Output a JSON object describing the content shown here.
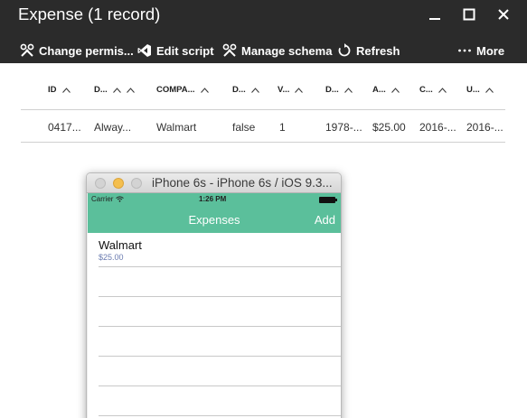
{
  "blade": {
    "title": "Expense (1 record)"
  },
  "toolbar": {
    "change_permissions": "Change permis...",
    "edit_script": "Edit script",
    "manage_schema": "Manage schema",
    "refresh": "Refresh",
    "more": "More"
  },
  "table": {
    "columns": [
      "ID",
      "D...",
      "COMPA...",
      "D...",
      "V...",
      "D...",
      "A...",
      "C...",
      "U..."
    ],
    "rows": [
      [
        "0417...",
        "Alway...",
        "Walmart",
        "false",
        "1",
        "1978-...",
        "$25.00",
        "2016-...",
        "2016-..."
      ]
    ]
  },
  "simulator": {
    "title": "iPhone 6s - iPhone 6s / iOS 9.3...",
    "status": {
      "carrier": "Carrier",
      "time": "1:26 PM"
    },
    "nav": {
      "title": "Expenses",
      "add": "Add"
    },
    "items": [
      {
        "title": "Walmart",
        "subtitle": "$25.00"
      }
    ]
  },
  "colors": {
    "header_bg": "#2b2b2b",
    "ios_accent": "#5bbf9b",
    "subtitle": "#6a7bb0"
  },
  "icons": [
    "wrench-icon",
    "visual-studio-icon",
    "refresh-icon",
    "ellipsis-icon",
    "minimize-icon",
    "maximize-icon",
    "close-icon",
    "sort-arrow-icon",
    "wifi-icon",
    "battery-icon"
  ]
}
